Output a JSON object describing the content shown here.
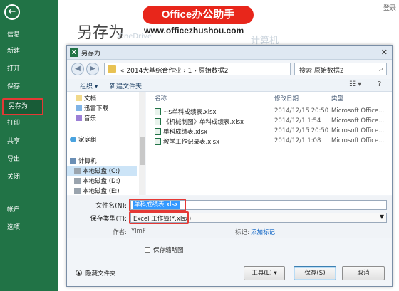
{
  "backstage": {
    "title": "另存为",
    "top_right": "登录",
    "sidebar": {
      "back": "←",
      "items": [
        "信息",
        "新建",
        "打开",
        "保存",
        "另存为",
        "打印",
        "共享",
        "导出",
        "关闭",
        "帐户",
        "选项"
      ],
      "active": "另存为"
    },
    "banner": {
      "brand": "Office办公助手",
      "url": "www.officezhushou.com"
    },
    "ghost": {
      "onedrive": "OneDrive",
      "computer": "计算机"
    }
  },
  "dialog": {
    "title": "另存为",
    "close": "✕",
    "address": {
      "crumbs": [
        "«",
        "2014大基综合作业",
        "›",
        "1",
        "›",
        "原始数据2"
      ]
    },
    "search_placeholder": "搜索 原始数据2",
    "toolbar": {
      "organize": "组织 ▾",
      "new_folder": "新建文件夹"
    },
    "nav": [
      {
        "label": "文档",
        "icon": "document-icon"
      },
      {
        "label": "迅雷下载",
        "icon": "download-icon"
      },
      {
        "label": "音乐",
        "icon": "music-icon"
      },
      {
        "label": "家庭组",
        "icon": "homegroup-icon"
      },
      {
        "label": "计算机",
        "icon": "computer-icon"
      },
      {
        "label": "本地磁盘 (C:)",
        "icon": "drive-icon"
      },
      {
        "label": "本地磁盘 (D:)",
        "icon": "drive-icon"
      },
      {
        "label": "本地磁盘 (E:)",
        "icon": "drive-icon"
      }
    ],
    "columns": {
      "name": "名称",
      "date": "修改日期",
      "type": "类型"
    },
    "files": [
      {
        "name": "~$单科成绩表.xlsx",
        "date": "2014/12/15 20:50",
        "type": "Microsoft Office..."
      },
      {
        "name": "《机械制图》单科成绩表.xlsx",
        "date": "2014/12/1 1:54",
        "type": "Microsoft Office..."
      },
      {
        "name": "单科成绩表.xlsx",
        "date": "2014/12/15 20:50",
        "type": "Microsoft Office..."
      },
      {
        "name": "教学工作记录表.xlsx",
        "date": "2014/12/1 1:08",
        "type": "Microsoft Office..."
      }
    ],
    "fields": {
      "filename_label": "文件名(N):",
      "filename_value": "单科成绩表.xlsx",
      "filetype_label": "保存类型(T):",
      "filetype_value": "Excel 工作簿(*.xlsx)",
      "author_label": "作者:",
      "author_value": "YlmF",
      "tags_label": "标记:",
      "tags_link": "添加标记"
    },
    "save_thumbnail": "保存缩略图",
    "hide_folders": "隐藏文件夹",
    "buttons": {
      "tools": "工具(L)",
      "save": "保存(S)",
      "cancel": "取消"
    }
  },
  "colors": {
    "excel_green": "#217346",
    "highlight_red": "#e53935",
    "banner_red": "#e8261b",
    "selection_blue": "#3399ff"
  }
}
